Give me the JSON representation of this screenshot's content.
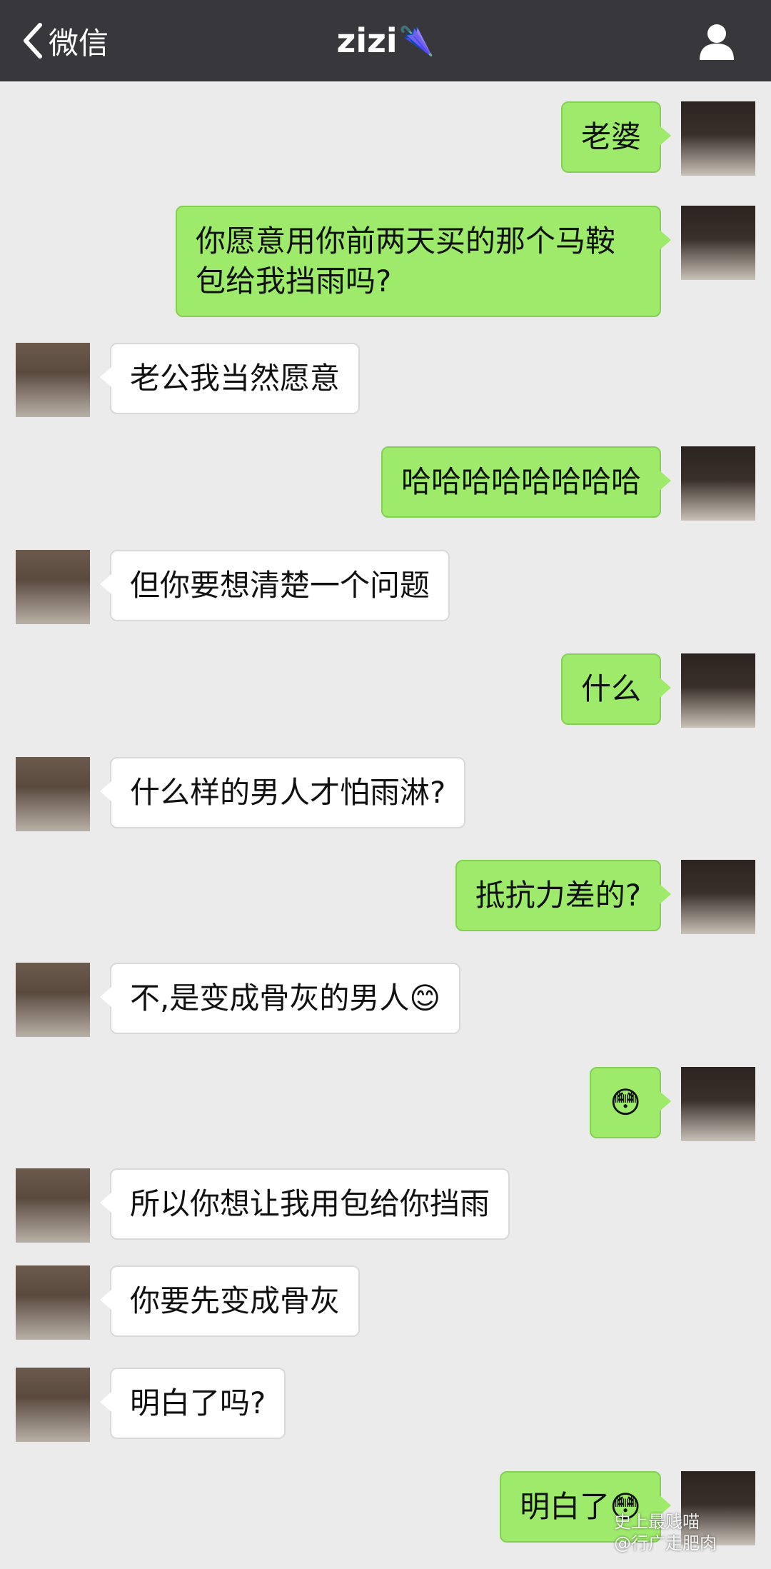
{
  "nav": {
    "back_label": "微信",
    "title": "zizi",
    "title_emoji": "🌂",
    "back_icon": "chevron-left-icon",
    "profile_icon": "person-icon"
  },
  "messages": [
    {
      "side": "right",
      "text": "老婆"
    },
    {
      "side": "right",
      "text": "你愿意用你前两天买的那个马鞍包给我挡雨吗?"
    },
    {
      "side": "left",
      "text": "老公我当然愿意"
    },
    {
      "side": "right",
      "text": "哈哈哈哈哈哈哈哈"
    },
    {
      "side": "left",
      "text": "但你要想清楚一个问题"
    },
    {
      "side": "right",
      "text": "什么"
    },
    {
      "side": "left",
      "text": "什么样的男人才怕雨淋?"
    },
    {
      "side": "right",
      "text": "抵抗力差的?"
    },
    {
      "side": "left",
      "text": "不,是变成骨灰的男人😊"
    },
    {
      "side": "right",
      "text": "😳"
    },
    {
      "side": "left",
      "text": "所以你想让我用包给你挡雨"
    },
    {
      "side": "left",
      "text": "你要先变成骨灰"
    },
    {
      "side": "left",
      "text": "明白了吗?"
    },
    {
      "side": "right",
      "text": "明白了😳"
    }
  ],
  "watermark": {
    "line1": "史上最贱喵",
    "line2": "@行广走肥肉"
  },
  "colors": {
    "nav_bg": "#38373c",
    "chat_bg": "#ebebeb",
    "sent_bubble": "#9eea6a",
    "received_bubble": "#ffffff"
  }
}
